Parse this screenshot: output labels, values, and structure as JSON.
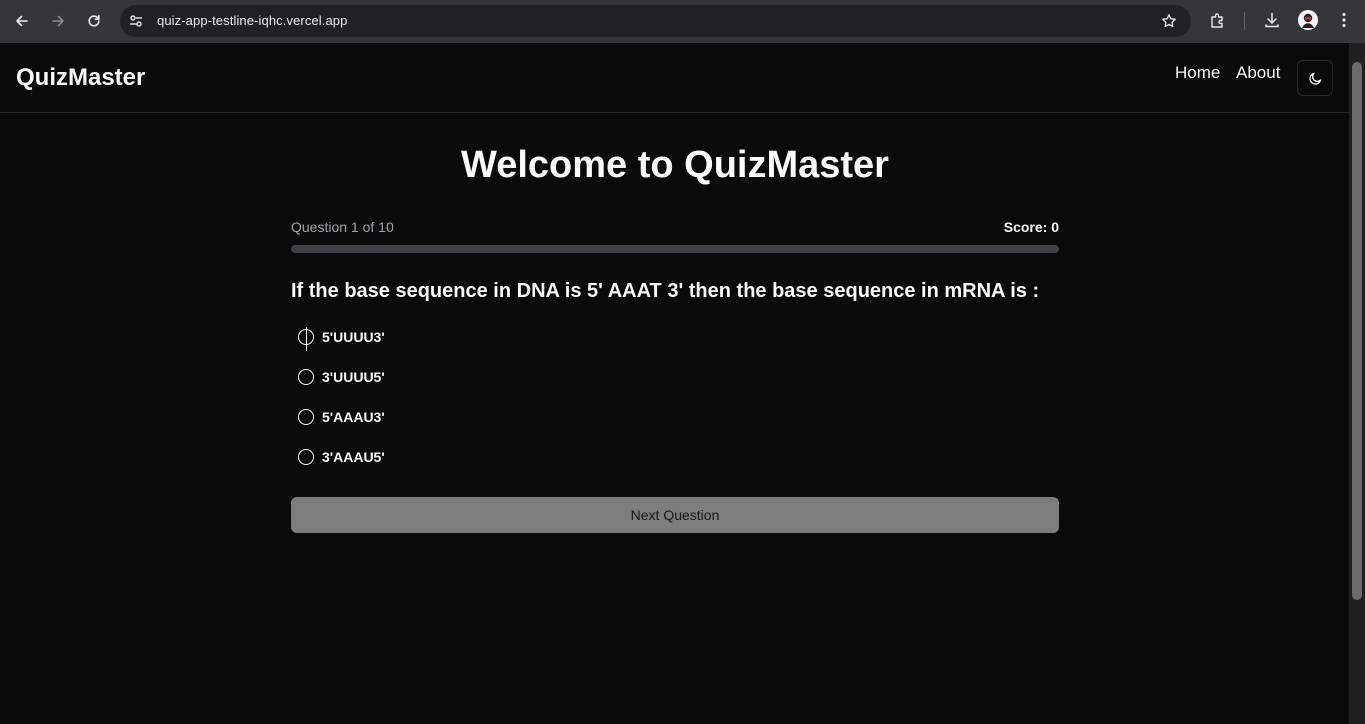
{
  "browser": {
    "url": "quiz-app-testline-iqhc.vercel.app",
    "icons": {
      "back": "arrow-left-icon",
      "forward": "arrow-right-icon",
      "reload": "reload-icon",
      "site_settings": "tune-icon",
      "bookmark": "star-icon",
      "extensions": "puzzle-icon",
      "downloads": "download-icon",
      "profile": "avatar",
      "menu": "kebab-menu-icon"
    }
  },
  "header": {
    "brand": "QuizMaster",
    "nav": [
      {
        "label": "Home"
      },
      {
        "label": "About"
      }
    ],
    "theme_toggle_icon": "moon-icon"
  },
  "main": {
    "title": "Welcome to QuizMaster",
    "progress_text": "Question 1 of 10",
    "score_text": "Score: 0",
    "progress_fraction": 0,
    "question": "If the base sequence in DNA is 5' AAAT 3' then the base sequence in mRNA is :",
    "options": [
      {
        "label": "5'UUUU3'"
      },
      {
        "label": "3'UUUU5'"
      },
      {
        "label": "5'AAAU3'"
      },
      {
        "label": "3'AAAU5'"
      }
    ],
    "next_button": "Next Question"
  },
  "colors": {
    "background": "#0a0a0a",
    "foreground": "#fafafa",
    "muted": "#a1a1aa",
    "border": "#27272a",
    "track": "#3f3f46",
    "button_disabled": "#7d7d7d",
    "chrome_bar": "#35363a",
    "omnibox": "#202124"
  }
}
